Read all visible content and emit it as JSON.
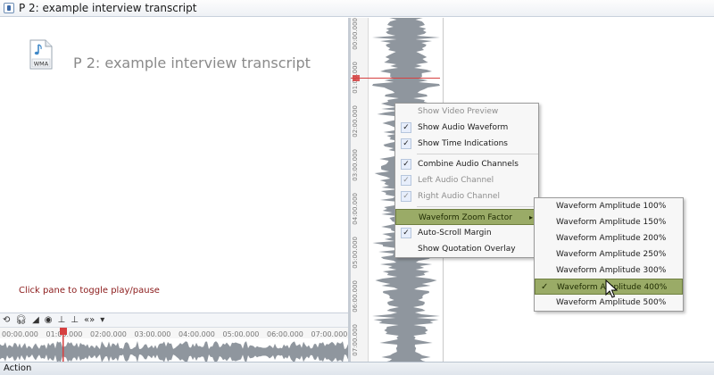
{
  "window": {
    "title": "P 2: example interview transcript"
  },
  "document": {
    "file_type_label": "WMA",
    "title": "P 2: example interview transcript",
    "toggle_hint": "Click pane to toggle play/pause"
  },
  "media_toolbar": {
    "quote_label": "«»",
    "timeline_ticks": [
      "00:00.000",
      "01:00.000",
      "02:00.000",
      "03:00.000",
      "04:00.000",
      "05:00.000",
      "06:00.000",
      "07:00.000"
    ]
  },
  "waveform_ruler": {
    "ticks": [
      "00:00.000",
      "01:00.000",
      "02:00.000",
      "03:00.000",
      "04:00.000",
      "05:00.000",
      "06:00.000",
      "07:00.000"
    ]
  },
  "status_bar": {
    "text": "Action"
  },
  "context_menu": {
    "items": [
      {
        "label": "Show Video Preview",
        "checked": false,
        "enabled": false
      },
      {
        "label": "Show Audio Waveform",
        "checked": true,
        "enabled": true
      },
      {
        "label": "Show Time Indications",
        "checked": true,
        "enabled": true
      },
      {
        "label": "Combine Audio Channels",
        "checked": true,
        "enabled": true
      },
      {
        "label": "Left Audio Channel",
        "checked": true,
        "enabled": false
      },
      {
        "label": "Right Audio Channel",
        "checked": true,
        "enabled": false
      },
      {
        "label": "Waveform Zoom Factor",
        "submenu": true,
        "highlighted": true
      },
      {
        "label": "Auto-Scroll Margin",
        "checked": true,
        "enabled": true
      },
      {
        "label": "Show Quotation Overlay",
        "checked": false,
        "enabled": true
      }
    ],
    "check_glyph": "✓",
    "submenu_arrow": "▸"
  },
  "zoom_submenu": {
    "items": [
      {
        "label": "Waveform Amplitude 100%"
      },
      {
        "label": "Waveform Amplitude 150%"
      },
      {
        "label": "Waveform Amplitude 200%"
      },
      {
        "label": "Waveform Amplitude 250%"
      },
      {
        "label": "Waveform Amplitude 300%"
      },
      {
        "label": "Waveform Amplitude 400%",
        "selected": true
      },
      {
        "label": "Waveform Amplitude 500%"
      }
    ]
  },
  "colors": {
    "menu_highlight": "#9aab67",
    "playhead": "#d64040",
    "hint_text": "#8b1a1a",
    "waveform": "#8f969e"
  }
}
